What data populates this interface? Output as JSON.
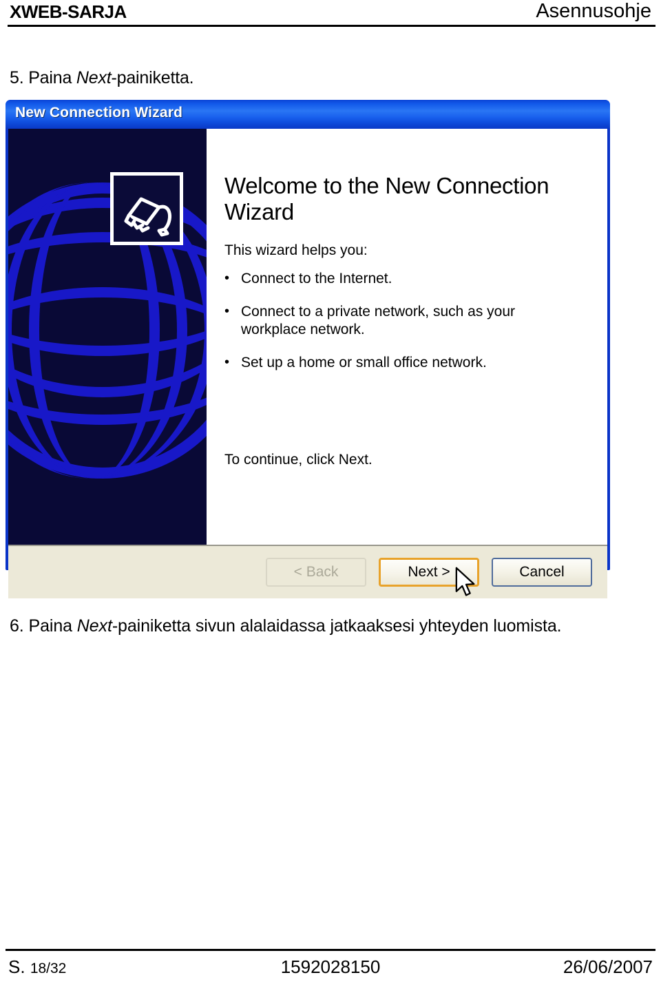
{
  "page_header": {
    "left_title": "XWEB-SARJA",
    "right_title": "Asennusohje"
  },
  "steps": {
    "step5": {
      "number": "5. ",
      "emphasis": "Next",
      "text_after": "-painiketta."
    },
    "step6": {
      "number": "6. ",
      "text_before": "Paina ",
      "emphasis": "Next",
      "text_after": "-painiketta sivun alalaidassa jatkaaksesi yhteyden luomista."
    },
    "step5_text_before": "Paina "
  },
  "dialog": {
    "title": "New Connection Wizard",
    "icon_name": "network-plug-icon",
    "sidebar_graphic": "globe-wireframe-graphic",
    "heading": "Welcome to the New Connection Wizard",
    "intro": "This wizard helps you:",
    "bullets": [
      "Connect to the Internet.",
      "Connect to a private network, such as your workplace network.",
      "Set up a home or small office network."
    ],
    "bullet_glyph": "•",
    "continue_text": "To continue, click Next.",
    "buttons": {
      "back": "< Back",
      "next": "Next >",
      "cancel": "Cancel"
    },
    "colors": {
      "titlebar_blue": "#1157e8",
      "frame_blue": "#0a34c8",
      "sidebar_navy": "#090936",
      "globe_blue": "#1818c8",
      "buttonbar_beige": "#ece9d8",
      "default_button_border": "#e8a22a"
    }
  },
  "page_footer": {
    "page_prefix": "S.",
    "page_number": "18/32",
    "document_number": "1592028150",
    "date": "26/06/2007"
  }
}
